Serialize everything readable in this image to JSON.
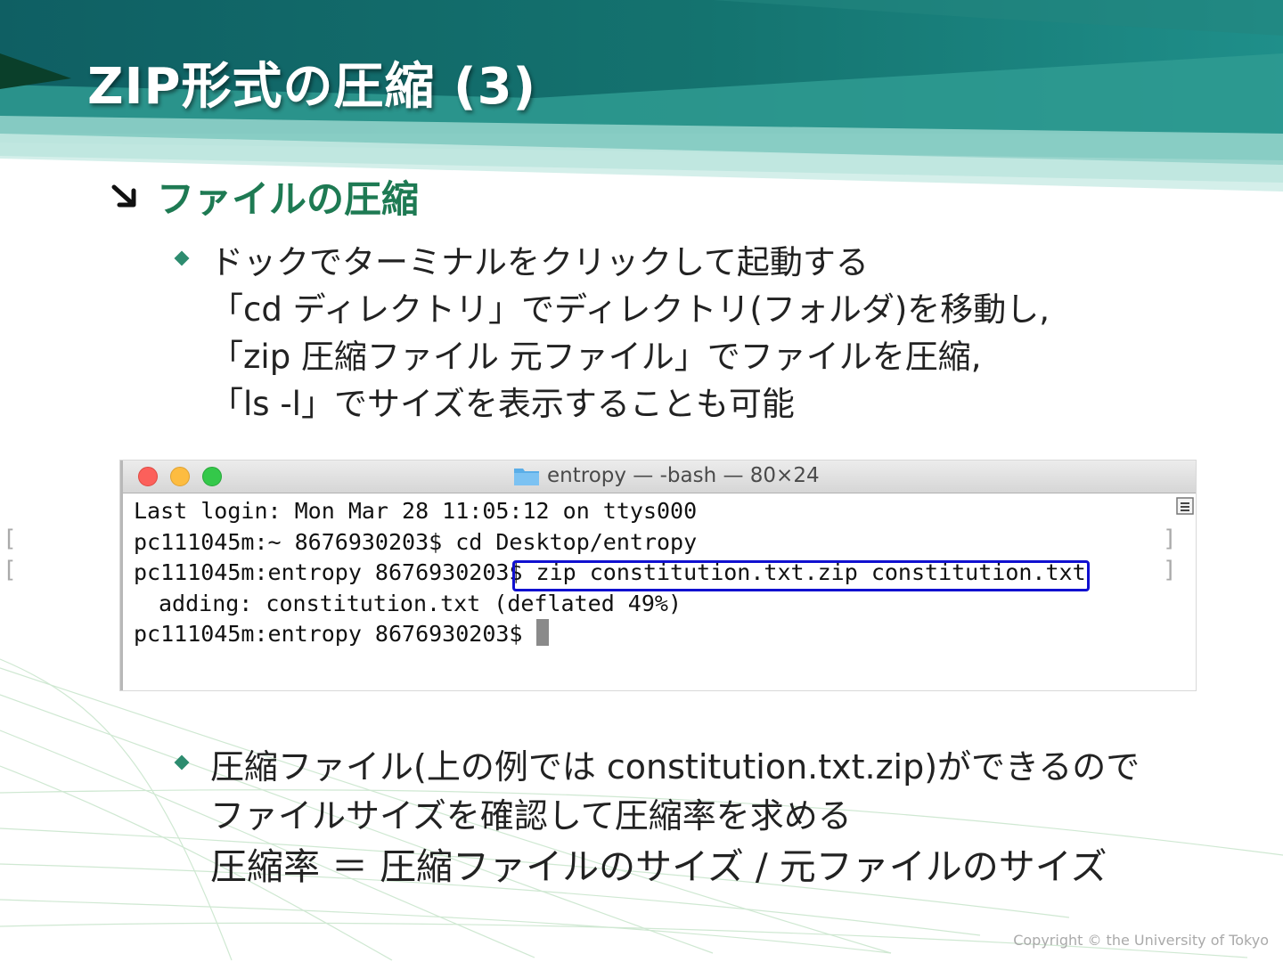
{
  "slide": {
    "title": "ZIP形式の圧縮 (3)",
    "section_heading": "ファイルの圧縮",
    "bullet1_lines": [
      "ドックでターミナルをクリックして起動する",
      "「cd ディレクトリ」でディレクトリ(フォルダ)を移動し,",
      "「zip 圧縮ファイル 元ファイル」でファイルを圧縮,",
      "「ls -l」でサイズを表示することも可能"
    ],
    "bullet2_lines": [
      "圧縮ファイル(上の例では constitution.txt.zip)ができるので",
      "ファイルサイズを確認して圧縮率を求める",
      "圧縮率 ＝ 圧縮ファイルのサイズ / 元ファイルのサイズ"
    ],
    "copyright": "Copyright © the University of Tokyo",
    "accent_color": "#1e7a53",
    "header_color": "#16706f"
  },
  "terminal": {
    "title": "entropy — -bash — 80×24",
    "lines": [
      "Last login: Mon Mar 28 11:05:12 on ttys000",
      "pc111045m:~ 8676930203$ cd Desktop/entropy",
      "pc111045m:entropy 8676930203$ zip constitution.txt.zip constitution.txt",
      "adding: constitution.txt (deflated 49%)",
      "pc111045m:entropy 8676930203$ "
    ],
    "highlight_color": "#1010d0"
  }
}
